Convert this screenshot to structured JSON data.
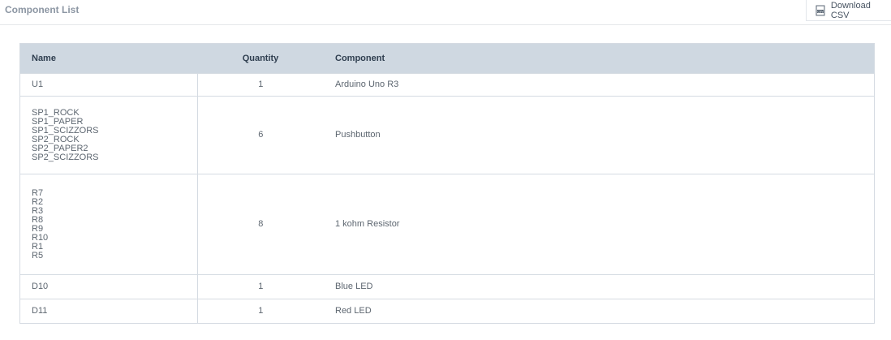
{
  "header": {
    "title": "Component List",
    "download_label": "Download CSV",
    "download_icon": "csv-file-icon"
  },
  "table": {
    "columns": [
      "Name",
      "Quantity",
      "Component"
    ],
    "rows": [
      {
        "name": "U1",
        "quantity": "1",
        "component": "Arduino Uno R3"
      },
      {
        "name": "SP1_ROCK\nSP1_PAPER\nSP1_SCIZZORS\nSP2_ROCK\nSP2_PAPER2\nSP2_SCIZZORS",
        "quantity": "6",
        "component": "Pushbutton"
      },
      {
        "name": "R7\nR2\nR3\nR8\nR9\nR10\nR1\nR5",
        "quantity": "8",
        "component": "1 kohm Resistor"
      },
      {
        "name": "D10",
        "quantity": "1",
        "component": "Blue LED"
      },
      {
        "name": "D11",
        "quantity": "1",
        "component": "Red LED"
      }
    ]
  },
  "colors": {
    "header_bg": "#cfd8e1",
    "border": "#d5dbe2",
    "title": "#8c96a3"
  }
}
